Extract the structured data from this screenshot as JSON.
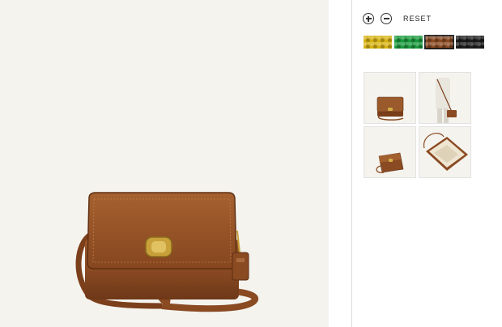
{
  "viewer": {
    "main_image_icon": "leather-crossbody-bag-image"
  },
  "controls": {
    "zoom_in_icon": "plus-circle-icon",
    "zoom_out_icon": "minus-circle-icon",
    "reset_label": "RESET"
  },
  "colors": {
    "swatches": [
      {
        "name": "yellow-swatch",
        "hex": "#d8b313"
      },
      {
        "name": "green-swatch",
        "hex": "#1a9a3c"
      },
      {
        "name": "brown-swatch",
        "hex": "#8a4a22",
        "selected": true
      },
      {
        "name": "black-swatch",
        "hex": "#1e1e1e"
      }
    ],
    "bag_leather": "#8b4b22",
    "background": "#f4f3ee"
  },
  "thumbnails": [
    {
      "icon": "bag-front-view-thumbnail"
    },
    {
      "icon": "bag-worn-model-thumbnail"
    },
    {
      "icon": "bag-angle-view-thumbnail"
    },
    {
      "icon": "bag-interior-view-thumbnail"
    }
  ]
}
